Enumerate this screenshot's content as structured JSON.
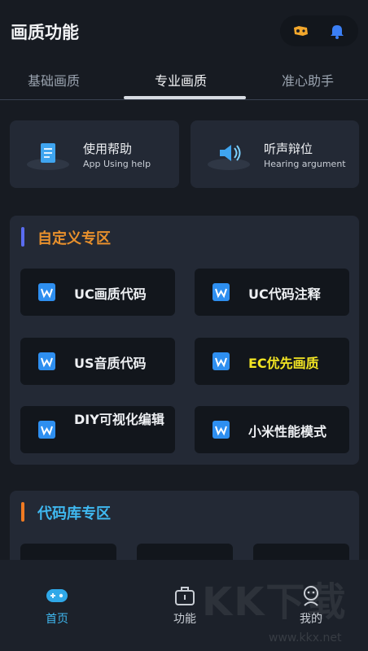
{
  "header": {
    "title": "画质功能",
    "icons": [
      "game-controller-icon",
      "bell-icon"
    ]
  },
  "tabs": [
    {
      "label": "基础画质",
      "active": false
    },
    {
      "label": "专业画质",
      "active": true
    },
    {
      "label": "准心助手",
      "active": false
    }
  ],
  "help_cards": [
    {
      "title": "使用帮助",
      "subtitle": "App Using help",
      "icon": "document-icon"
    },
    {
      "title": "听声辩位",
      "subtitle": "Hearing argument",
      "icon": "sound-icon"
    }
  ],
  "custom_section": {
    "title": "自定义专区",
    "accent": "#e8902c",
    "bar_color": "#5a6cf0",
    "tiles": [
      {
        "label": "UC画质代码"
      },
      {
        "label": "UC代码注释"
      },
      {
        "label": "US音质代码"
      },
      {
        "label": "EC优先画质",
        "highlight": "#f3e523"
      },
      {
        "label": "DIY可视化编辑"
      },
      {
        "label": "小米性能模式"
      }
    ]
  },
  "library_section": {
    "title": "代码库专区",
    "accent": "#3fb8f0",
    "bar_color": "#f07a22"
  },
  "bottom_nav": [
    {
      "label": "首页",
      "icon": "gamepad-icon",
      "active": true
    },
    {
      "label": "功能",
      "icon": "toolbox-icon",
      "active": false
    },
    {
      "label": "我的",
      "icon": "profile-icon",
      "active": false
    }
  ],
  "watermark": {
    "text": "KK下载",
    "url": "www.kkx.net"
  }
}
